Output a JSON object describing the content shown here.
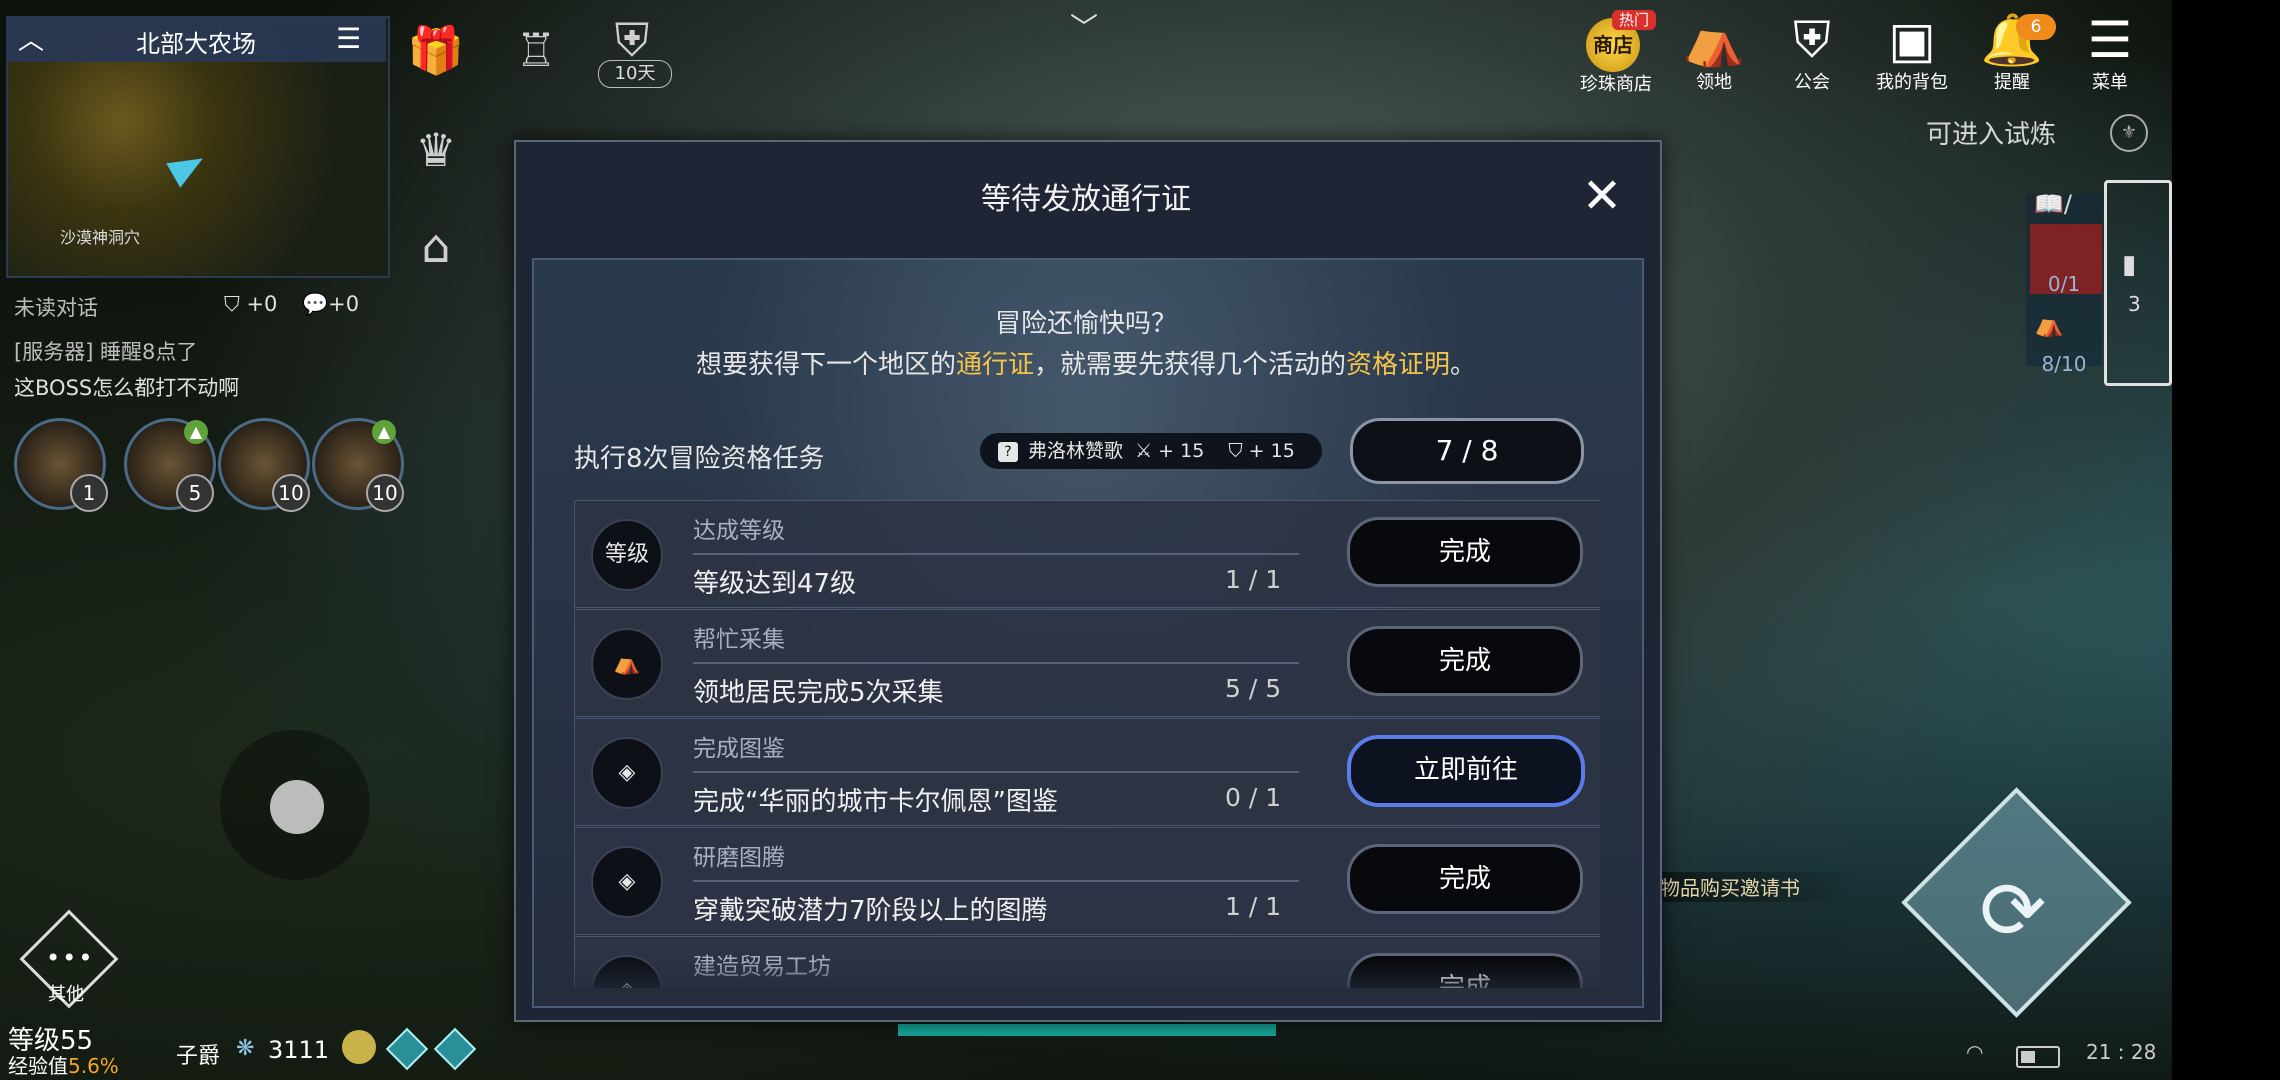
{
  "minimap": {
    "title": "北部大农场",
    "location_label": "沙漠神洞穴"
  },
  "top_left": {
    "days_badge": "10天"
  },
  "chat": {
    "unread": "未读对话",
    "shield_count": "+0",
    "chat_count": "+0",
    "messages": [
      "[服务器] 睡醒8点了",
      "这BOSS怎么都打不动啊"
    ]
  },
  "pets": [
    {
      "level": "1",
      "up": false
    },
    {
      "level": "5",
      "up": true
    },
    {
      "level": "10",
      "up": false
    },
    {
      "level": "10",
      "up": true
    }
  ],
  "bottom_left": {
    "other_label": "其他",
    "level_text": "等级55",
    "exp_label": "经验值",
    "exp_value": "5.6%",
    "rank_label": "子爵",
    "rank_value": "3111"
  },
  "top_right": {
    "items": [
      {
        "label": "珍珠商店",
        "icon": "shop-coin-icon",
        "coin_text": "商店"
      },
      {
        "label": "领地",
        "icon": "tent-flag-icon"
      },
      {
        "label": "公会",
        "icon": "guild-shield-icon"
      },
      {
        "label": "我的背包",
        "icon": "bag-icon"
      },
      {
        "label": "提醒",
        "icon": "bell-icon"
      },
      {
        "label": "菜单",
        "icon": "hamburger-icon"
      }
    ],
    "hot_badge": "热门",
    "bell_count": "6"
  },
  "right_side": {
    "trial": "可进入试炼",
    "count_a": "0/1",
    "count_b": "8/10",
    "quest_count": "3",
    "invite": "物品购买邀请书"
  },
  "status": {
    "time": "21 : 28"
  },
  "modal": {
    "title": "等待发放通行证",
    "intro_line1": "冒险还愉快吗？",
    "intro_line2_a": "想要获得下一个地区的",
    "intro_line2_hl1": "通行证",
    "intro_line2_b": "，就需要先获得几个活动的",
    "intro_line2_hl2": "资格证明",
    "intro_line2_c": "。",
    "exec_label": "执行8次冒险资格任务",
    "reward_name": "弗洛林赞歌",
    "reward_atk": "+ 15",
    "reward_def": "+ 15",
    "progress": "7 / 8",
    "tasks": [
      {
        "icon": "等级",
        "category": "达成等级",
        "desc": "等级达到47级",
        "count": "1 / 1",
        "button": "完成",
        "go": false
      },
      {
        "icon": "⛺",
        "category": "帮忙采集",
        "desc": "领地居民完成5次采集",
        "count": "5 / 5",
        "button": "完成",
        "go": false
      },
      {
        "icon": "◈",
        "category": "完成图鉴",
        "desc": "完成“华丽的城市卡尔佩恩”图鉴",
        "count": "0 / 1",
        "button": "立即前往",
        "go": true
      },
      {
        "icon": "◈",
        "category": "研磨图腾",
        "desc": "穿戴突破潜力7阶段以上的图腾",
        "count": "1 / 1",
        "button": "完成",
        "go": false
      },
      {
        "icon": "◈",
        "category": "建造贸易工坊",
        "desc": "",
        "count": "",
        "button": "完成",
        "go": false
      }
    ]
  }
}
